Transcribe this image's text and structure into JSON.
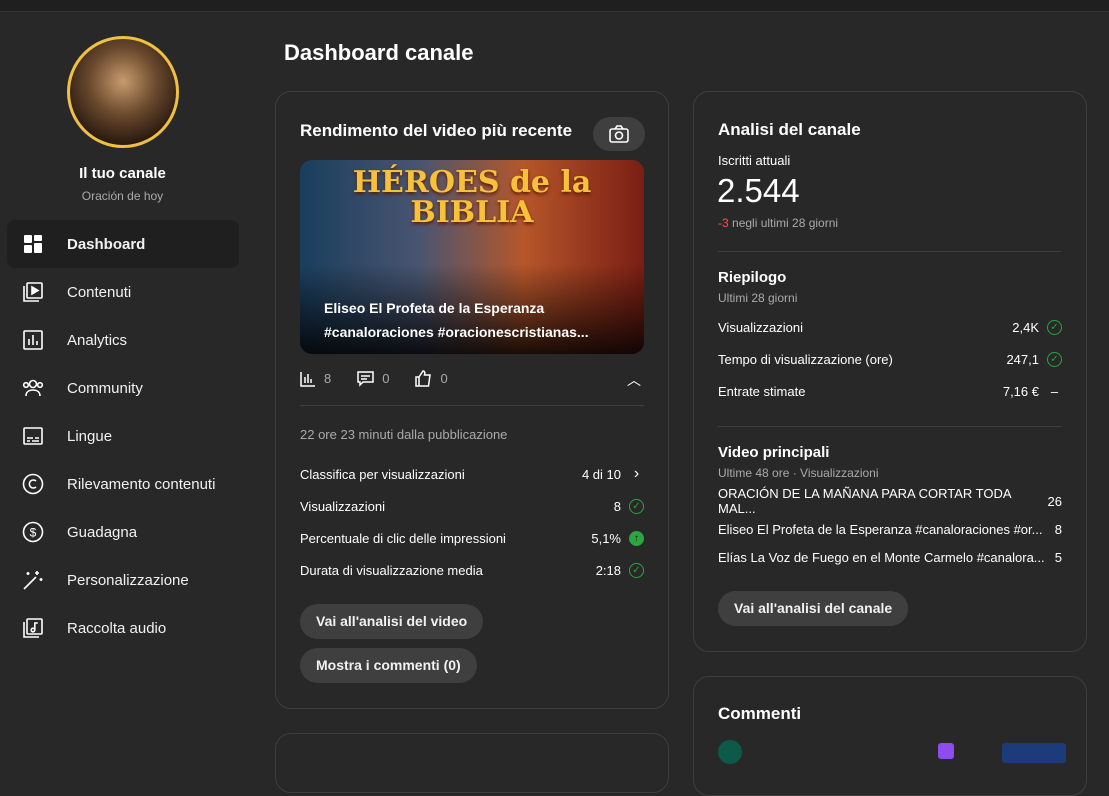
{
  "sidebar": {
    "channel_title": "Il tuo canale",
    "channel_name": "Oración de hoy",
    "items": [
      {
        "label": "Dashboard"
      },
      {
        "label": "Contenuti"
      },
      {
        "label": "Analytics"
      },
      {
        "label": "Community"
      },
      {
        "label": "Lingue"
      },
      {
        "label": "Rilevamento contenuti"
      },
      {
        "label": "Guadagna"
      },
      {
        "label": "Personalizzazione"
      },
      {
        "label": "Raccolta audio"
      }
    ]
  },
  "page_title": "Dashboard canale",
  "latest": {
    "title": "Rendimento del video più recente",
    "thumb_logo": "HÉROES de la BIBLIA",
    "video_title": "Eliseo El Profeta de la Esperanza #canaloraciones #oracionescristianas...",
    "views": "8",
    "comments": "0",
    "likes": "0",
    "since": "22 ore 23 minuti dalla pubblicazione",
    "stats": [
      {
        "label": "Classifica per visualizzazioni",
        "value": "4 di 10"
      },
      {
        "label": "Visualizzazioni",
        "value": "8"
      },
      {
        "label": "Percentuale di clic delle impressioni",
        "value": "5,1%"
      },
      {
        "label": "Durata di visualizzazione media",
        "value": "2:18"
      }
    ],
    "btn_analytics": "Vai all'analisi del video",
    "btn_comments": "Mostra i commenti (0)"
  },
  "channel": {
    "title": "Analisi del canale",
    "subs_label": "Iscritti attuali",
    "subs": "2.544",
    "subs_delta": "-3",
    "subs_delta_text": "negli ultimi 28 giorni",
    "summary_title": "Riepilogo",
    "summary_period": "Ultimi 28 giorni",
    "summary": [
      {
        "label": "Visualizzazioni",
        "value": "2,4K"
      },
      {
        "label": "Tempo di visualizzazione (ore)",
        "value": "247,1"
      },
      {
        "label": "Entrate stimate",
        "value": "7,16 €"
      }
    ],
    "top_title": "Video principali",
    "top_period": "Ultime 48 ore · Visualizzazioni",
    "top": [
      {
        "title": "ORACIÓN DE LA MAÑANA PARA CORTAR TODA MAL...",
        "views": "26"
      },
      {
        "title": "Eliseo El Profeta de la Esperanza #canaloraciones #or...",
        "views": "8"
      },
      {
        "title": "Elías La Voz de Fuego en el Monte Carmelo #canalora...",
        "views": "5"
      }
    ],
    "btn": "Vai all'analisi del canale"
  },
  "comments": {
    "title": "Commenti"
  }
}
